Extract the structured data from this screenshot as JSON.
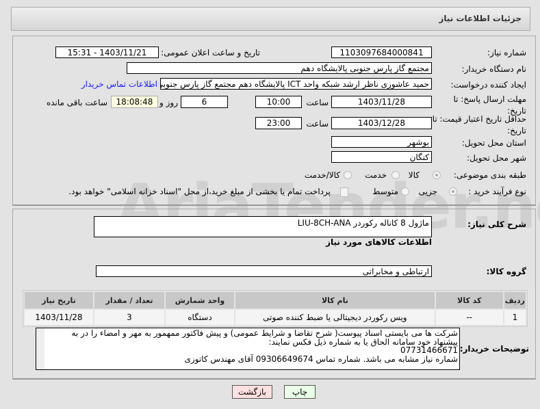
{
  "header": {
    "title": "جزئیات اطلاعات نیاز"
  },
  "form": {
    "need_number_label": "شماره نیاز:",
    "need_number": "1103097684000841",
    "announce_label": "تاریخ و ساعت اعلان عمومی:",
    "announce_value": "1403/11/21 - 15:31",
    "buyer_label": "نام دستگاه خریدار:",
    "buyer_value": "مجتمع گاز پارس جنوبی  پالایشگاه دهم",
    "creator_label": "ایجاد کننده درخواست:",
    "creator_value": "حمید عاشوری ناظر ارشد شبکه واحد ICT پالایشگاه دهم مجتمع گاز پارس جنوبی",
    "contact_link": "اطلاعات تماس خریدار",
    "deadline_label": "مهلت ارسال پاسخ: تا تاریخ:",
    "deadline_date": "1403/11/28",
    "time_label": "ساعت",
    "deadline_time": "10:00",
    "days": "6",
    "days_label": "روز و",
    "remaining": "18:08:48",
    "remaining_label": "ساعت باقی مانده",
    "validity_label": "حداقل تاریخ اعتبار قیمت: تا تاریخ:",
    "validity_date": "1403/12/28",
    "validity_time": "23:00",
    "province_label": "استان محل تحویل:",
    "province": "بوشهر",
    "city_label": "شهر محل تحویل:",
    "city": "کنگان",
    "category_label": "طبقه بندی موضوعی:",
    "category_options": [
      "کالا",
      "خدمت",
      "کالا/خدمت"
    ],
    "process_label": "نوع فرآیند خرید :",
    "process_options": [
      "جزیی",
      "متوسط"
    ],
    "payment_note": "پرداخت تمام یا بخشی از مبلغ خرید،از محل \"اسناد خزانه اسلامی\" خواهد بود."
  },
  "details": {
    "desc_label": "شرح کلی نیاز:",
    "desc_value": "ماژول 8 کاناله رکوردر LIU-8CH-ANA",
    "goods_title": "اطلاعات کالاهای مورد نیاز",
    "group_label": "گروه کالا:",
    "group_value": "ارتباطی و مخابراتی",
    "table": {
      "headers": [
        "ردیف",
        "کد کالا",
        "نام کالا",
        "واحد شمارش",
        "تعداد / مقدار",
        "تاریخ نیاز"
      ],
      "rows": [
        [
          "1",
          "--",
          "ویس رکوردر دیجیتالی یا ضبط کننده صوتی",
          "دستگاه",
          "3",
          "1403/11/28"
        ]
      ]
    },
    "notes_label": "توضیحات خریدار:",
    "notes_lines": [
      "شرکت ها می بایستی اسناد پیوست( شرح تقاضا و شرایط عمومی) و پیش فاکتور ممهمور به مهر و امضاء را در به",
      "پیشنهاد خود سامانه الحاق  یا به شماره ذیل فکس نمایند:",
      "07731466671",
      "شماره نیاز مشابه می باشد. شماره تماس 09306649674 آقای مهندس کاتوزی"
    ]
  },
  "buttons": {
    "print": "چاپ",
    "back": "بازگشت"
  },
  "watermark": "AriaTender.net",
  "colors": {
    "link": "#1a1aff",
    "remaining_bg": "#ffffe0",
    "back_bg": "#ffe0e0",
    "print_bg": "#e8ffe8"
  }
}
